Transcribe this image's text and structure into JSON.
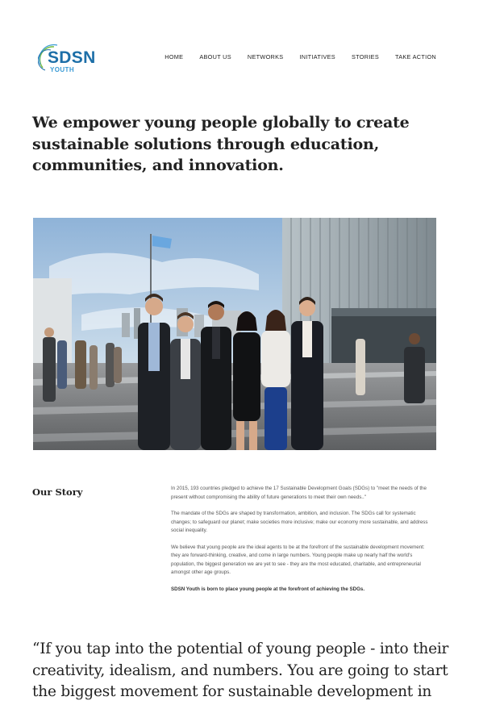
{
  "brand": {
    "logo_word": "SDSN",
    "logo_sub": "YOUTH",
    "colors": {
      "primary": "#1d6fa8",
      "accent_green": "#7cc04b",
      "accent_blue": "#3a9bd5"
    }
  },
  "nav": {
    "items": [
      "HOME",
      "ABOUT US",
      "NETWORKS",
      "INITIATIVES",
      "STORIES",
      "TAKE ACTION"
    ]
  },
  "hero": {
    "headline": "We empower young people globally to create sustainable solutions through education, communities, and innovation."
  },
  "photo": {
    "subject": "group-photo-un-plaza"
  },
  "story": {
    "title": "Our Story",
    "paragraphs": [
      "In 2015, 193 countries pledged to achieve the 17 Sustainable Development Goals (SDGs) to \"meet the needs of the present without compromising the ability of future generations to meet their own needs..\"",
      "The mandate of the SDGs are shaped by transformation, ambition, and inclusion. The SDGs call for systematic changes; to safeguard our planet; make societies more inclusive; make our economy more sustainable, and address social inequality.",
      "We believe that young people are the ideal agents to be at the forefront of the sustainable development movement: they are forward-thinking, creative, and come in large numbers. Young people make up nearly half the world's population, the biggest generation we are yet to see - they are the most educated, charitable, and entrepreneurial amongst other age groups."
    ],
    "closing": "SDSN Youth is born to place young people at the forefront of achieving the SDGs."
  },
  "quote": {
    "text": "“If you tap into the potential of young people - into their creativity, idealism, and numbers. You are going to start the biggest movement for sustainable development in"
  }
}
